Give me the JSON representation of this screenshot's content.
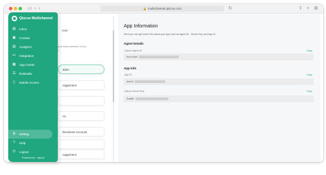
{
  "browser": {
    "url": "multichannel.qiscus.com"
  },
  "sidebar": {
    "brand": "Qiscus Multichannel",
    "items": [
      {
        "label": "Inbox",
        "icon": "inbox-icon"
      },
      {
        "label": "Contact",
        "icon": "contact-icon"
      },
      {
        "label": "Analytics",
        "icon": "analytics-icon"
      },
      {
        "label": "Integration",
        "icon": "integration-icon"
      },
      {
        "label": "App Center",
        "icon": "app-center-icon"
      },
      {
        "label": "Rolesabs",
        "icon": "roles-icon"
      },
      {
        "label": "Mobile Access",
        "icon": "mobile-icon"
      }
    ],
    "bottom_items": [
      {
        "label": "Setting",
        "icon": "gear-icon",
        "active": true
      },
      {
        "label": "Help",
        "icon": "help-icon"
      },
      {
        "label": "Logout",
        "icon": "logout-icon"
      }
    ],
    "powered_by": "Powered by",
    "powered_brand": "qiscus"
  },
  "middle": {
    "header_fragment": "nnel",
    "desc_fragment_1": "your team members or bot",
    "desc_fragment_2": "l.",
    "cards": [
      {
        "label": "ation",
        "active": true
      },
      {
        "label": "nagement",
        "active": false
      },
      {
        "label": "",
        "active": false
      },
      {
        "label": "ns",
        "active": false
      },
      {
        "label": "Business Account",
        "active": false
      },
      {
        "label": "",
        "active": false
      },
      {
        "label": "nagement",
        "active": false
      }
    ]
  },
  "main": {
    "title": "App Information",
    "description": "Here you can get some info about your app such as Agent ID , Secret Key, and App Id",
    "agent_details": {
      "heading": "Agent Details",
      "field_label": "Qiscus Agent ID",
      "value_prefix": "bon-c0md",
      "copy_label": "Copy"
    },
    "app_info": {
      "heading": "App Info",
      "app_id_label": "App ID",
      "app_id_prefix": "bot-k3",
      "app_id_copy": "Copy",
      "secret_label": "Qiscus Secret Key",
      "secret_prefix": "3ca8fd",
      "secret_copy": "Copy"
    }
  }
}
